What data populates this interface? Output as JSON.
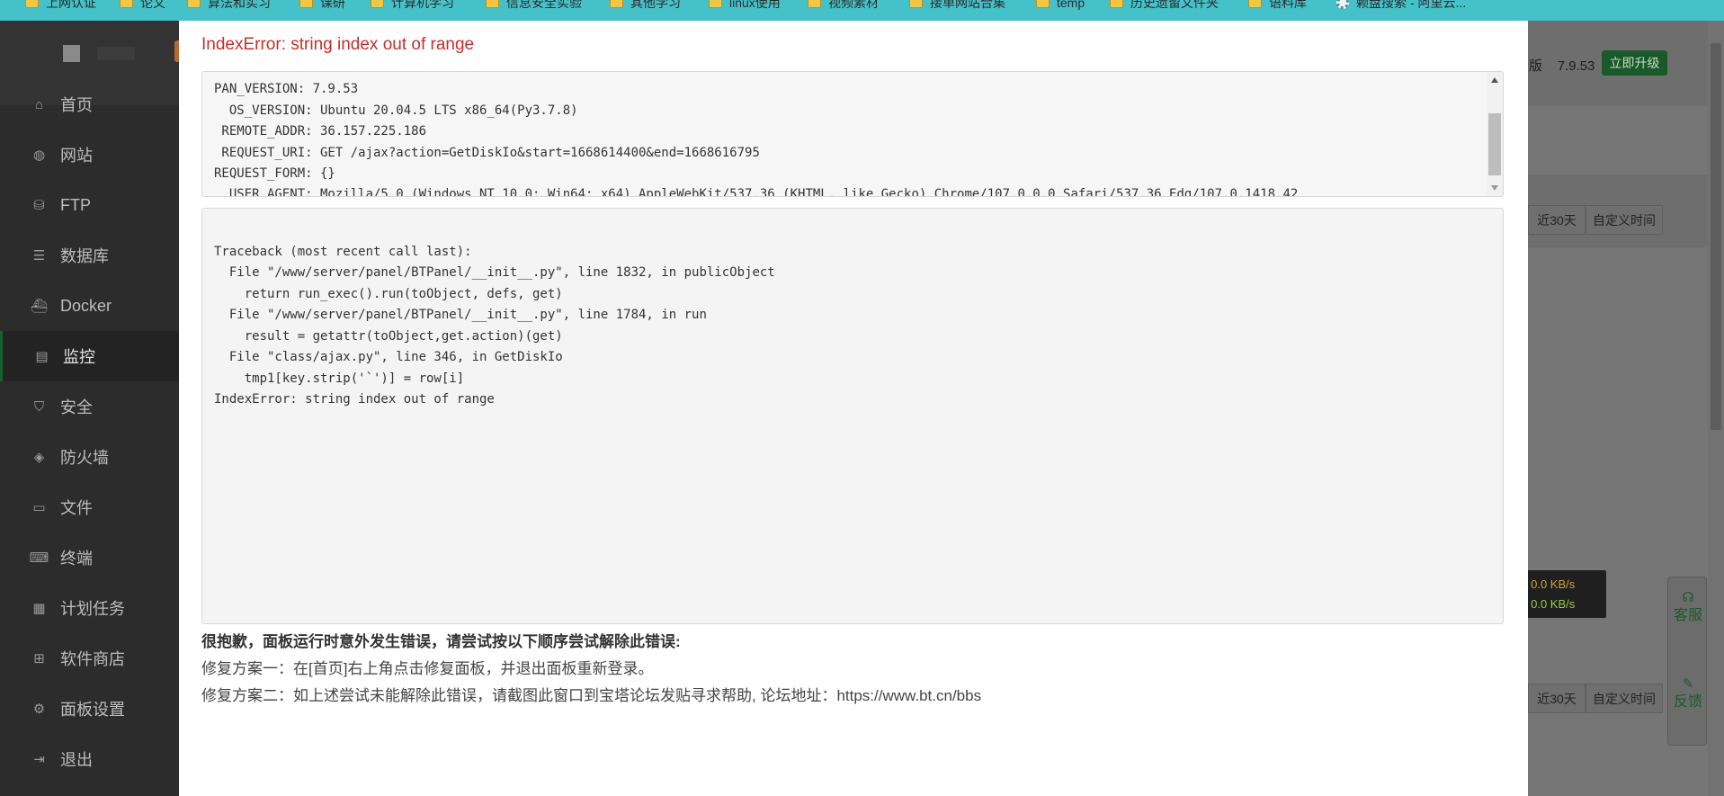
{
  "bookmarks": [
    {
      "label": "上网认证",
      "icon": "folder-icon"
    },
    {
      "label": "论文",
      "icon": "folder-icon"
    },
    {
      "label": "算法和实习",
      "icon": "folder-icon"
    },
    {
      "label": "课研",
      "icon": "folder-icon"
    },
    {
      "label": "计算机学习",
      "icon": "folder-icon"
    },
    {
      "label": "信息安全实验",
      "icon": "folder-icon"
    },
    {
      "label": "其他学习",
      "icon": "folder-icon"
    },
    {
      "label": "linux使用",
      "icon": "folder-icon"
    },
    {
      "label": "视频素材",
      "icon": "folder-icon"
    },
    {
      "label": "接单网站合集",
      "icon": "folder-icon"
    },
    {
      "label": "temp",
      "icon": "folder-icon"
    },
    {
      "label": "历史遗留文件夹",
      "icon": "folder-icon"
    },
    {
      "label": "语料库",
      "icon": "folder-icon"
    },
    {
      "label": "赖盘搜索 - 阿里云...",
      "icon": "site-icon"
    }
  ],
  "sidebar": {
    "items": [
      {
        "label": "首页",
        "icon": "home-icon"
      },
      {
        "label": "网站",
        "icon": "globe-icon"
      },
      {
        "label": "FTP",
        "icon": "ftp-icon"
      },
      {
        "label": "数据库",
        "icon": "database-icon"
      },
      {
        "label": "Docker",
        "icon": "docker-icon"
      },
      {
        "label": "监控",
        "icon": "monitor-icon",
        "active": true
      },
      {
        "label": "安全",
        "icon": "shield-check-icon"
      },
      {
        "label": "防火墙",
        "icon": "firewall-icon"
      },
      {
        "label": "文件",
        "icon": "folder-icon"
      },
      {
        "label": "终端",
        "icon": "terminal-icon"
      },
      {
        "label": "计划任务",
        "icon": "calendar-icon"
      },
      {
        "label": "软件商店",
        "icon": "grid-icon"
      },
      {
        "label": "面板设置",
        "icon": "gear-icon"
      },
      {
        "label": "退出",
        "icon": "logout-icon"
      }
    ]
  },
  "header": {
    "version_prefix": "版",
    "version": "7.9.53",
    "upgrade_label": "立即升级"
  },
  "background": {
    "range_30_label": "近30天",
    "custom_time_label": "自定义时间"
  },
  "netspeed": {
    "up": "↑ 0.0 KB/s",
    "down": "↓ 0.0 KB/s"
  },
  "float_buttons": {
    "service_label": "客服",
    "feedback_label": "反馈"
  },
  "modal": {
    "title": "IndexError: string index out of range",
    "info_lines": [
      "PAN_VERSION: 7.9.53",
      "  OS_VERSION: Ubuntu 20.04.5 LTS x86_64(Py3.7.8)",
      " REMOTE_ADDR: 36.157.225.186",
      " REQUEST_URI: GET /ajax?action=GetDiskIo&start=1668614400&end=1668616795",
      "REQUEST_FORM: {}",
      "  USER_AGENT: Mozilla/5.0 (Windows NT 10.0; Win64; x64) AppleWebKit/537.36 (KHTML, like Gecko) Chrome/107.0.0.0 Safari/537.36 Edg/107.0.1418.42"
    ],
    "traceback_lines": [
      "Traceback (most recent call last):",
      "  File \"/www/server/panel/BTPanel/__init__.py\", line 1832, in publicObject",
      "    return run_exec().run(toObject, defs, get)",
      "  File \"/www/server/panel/BTPanel/__init__.py\", line 1784, in run",
      "    result = getattr(toObject,get.action)(get)",
      "  File \"class/ajax.py\", line 346, in GetDiskIo",
      "    tmp1[key.strip('`')] = row[i]",
      "IndexError: string index out of range"
    ],
    "fix_title": "很抱歉，面板运行时意外发生错误，请尝试按以下顺序尝试解除此错误:",
    "fix_1": "修复方案一：在[首页]右上角点击修复面板，并退出面板重新登录。",
    "fix_2": "修复方案二：如上述尝试未能解除此错误，请截图此窗口到宝塔论坛发贴寻求帮助, 论坛地址：https://www.bt.cn/bbs"
  }
}
